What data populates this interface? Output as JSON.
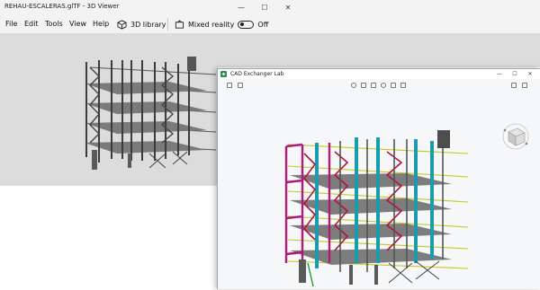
{
  "viewer": {
    "title": "REHAU-ESCALERAS.glTF - 3D Viewer",
    "window_controls": {
      "minimize": "—",
      "maximize": "☐",
      "close": "✕"
    },
    "menu": [
      "File",
      "Edit",
      "Tools",
      "View",
      "Help"
    ],
    "library_label": "3D library",
    "mixed_reality_label": "Mixed reality",
    "mixed_reality_state": "Off"
  },
  "cad": {
    "title": "CAD Exchanger Lab",
    "window_controls": {
      "minimize": "—",
      "maximize": "☐",
      "close": "✕"
    },
    "colors": {
      "magenta": "#b0197a",
      "cyan": "#1b9bb0",
      "yellow": "#c8c820",
      "gray": "#6e6e6e",
      "crimson": "#b4143c"
    }
  }
}
